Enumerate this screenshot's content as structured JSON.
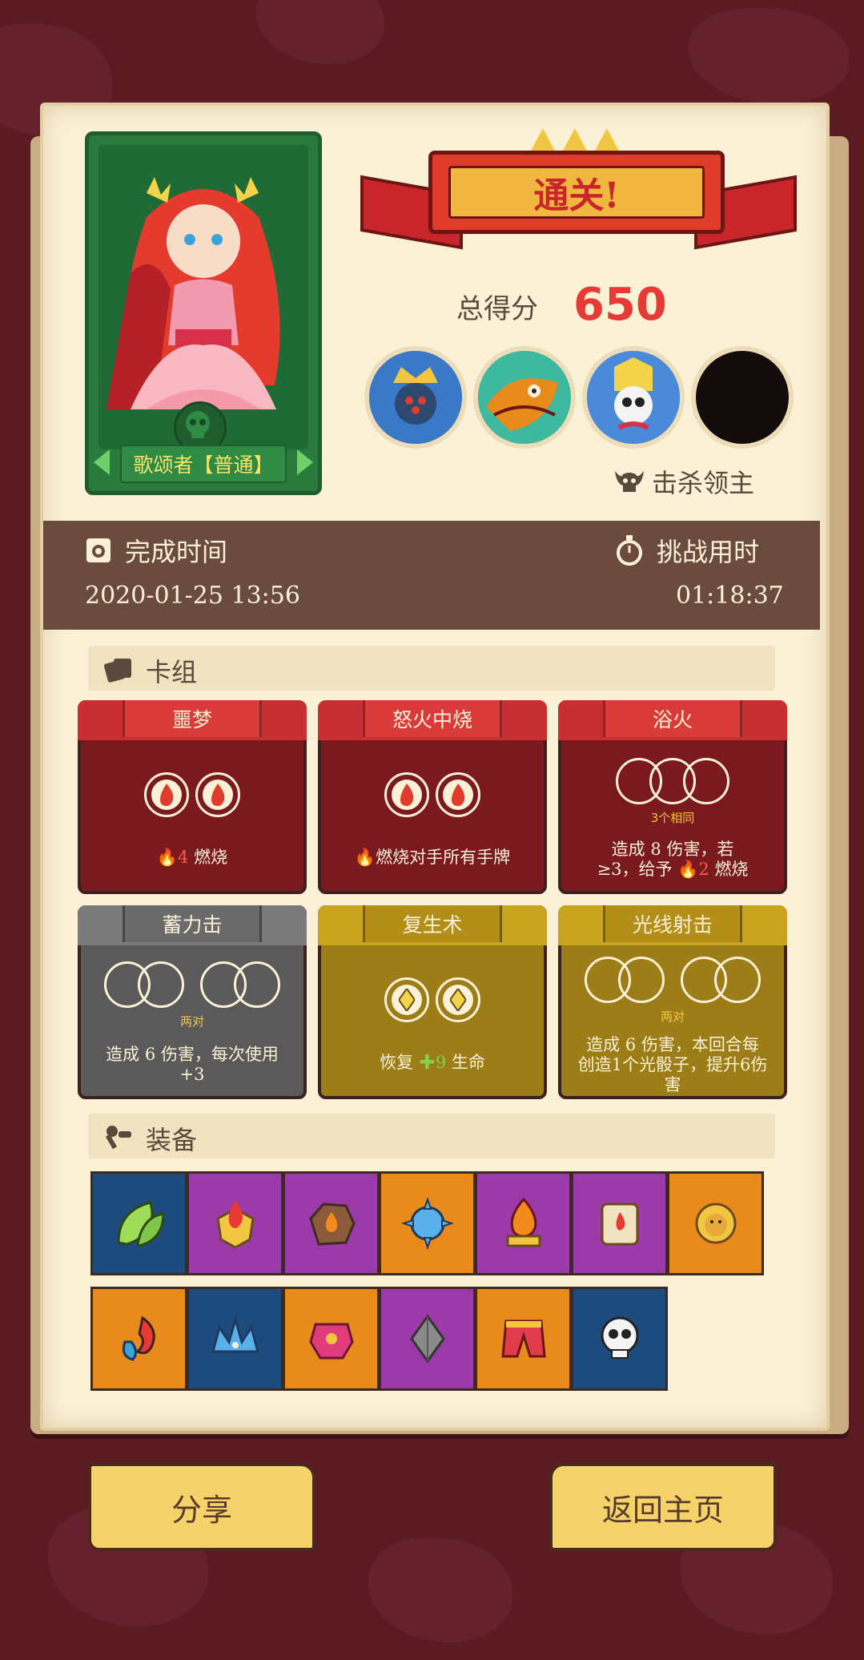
{
  "result": {
    "banner": "通关!",
    "score_label": "总得分",
    "score_value": "650",
    "kill_label": "击杀领主"
  },
  "hero": {
    "name": "歌颂者【普通】"
  },
  "bosses": [
    {
      "name": "boss-1-portrait"
    },
    {
      "name": "boss-2-portrait"
    },
    {
      "name": "boss-3-portrait"
    },
    {
      "name": "boss-4-locked"
    }
  ],
  "times": {
    "complete_label": "完成时间",
    "complete_value": "2020-01-25 13:56",
    "challenge_label": "挑战用时",
    "challenge_value": "01:18:37"
  },
  "deck": {
    "title": "卡组",
    "cards": [
      {
        "title": "噩梦",
        "color": "red",
        "dice": "fire-2",
        "effect_num": "4",
        "effect_text": "燃烧"
      },
      {
        "title": "怒火中烧",
        "color": "red",
        "dice": "fire-2",
        "effect_text": "燃烧对手所有手牌"
      },
      {
        "title": "浴火",
        "color": "red",
        "dice": "triple",
        "condition": "3个相同",
        "effect_line1": "造成 8 伤害，若",
        "effect_line2_a": "≥3，给予",
        "effect_line2_num": "2",
        "effect_line2_b": "燃烧"
      },
      {
        "title": "蓄力击",
        "color": "grey",
        "dice": "two-pair",
        "condition": "两对",
        "effect_line1": "造成 6 伤害，每次使用",
        "effect_line2": "+3"
      },
      {
        "title": "复生术",
        "color": "gold",
        "dice": "diamond-2",
        "effect_a": "恢复",
        "effect_num": "9",
        "effect_b": "生命"
      },
      {
        "title": "光线射击",
        "color": "gold",
        "dice": "two-pair",
        "condition": "两对",
        "effect_line1": "造成 6 伤害，本回合每",
        "effect_line2": "创造1个光骰子，提升6伤",
        "effect_line3": "害"
      }
    ]
  },
  "equipment": {
    "title": "装备",
    "row1": [
      {
        "icon": "leaf-icon",
        "bg": "#1e4b7e"
      },
      {
        "icon": "flame-shield-icon",
        "bg": "#9b3aa8"
      },
      {
        "icon": "fire-rock-icon",
        "bg": "#9b3aa8"
      },
      {
        "icon": "ice-mace-icon",
        "bg": "#e88a1c"
      },
      {
        "icon": "fire-altar-icon",
        "bg": "#9b3aa8"
      },
      {
        "icon": "fire-scroll-icon",
        "bg": "#9b3aa8"
      },
      {
        "icon": "lion-belt-icon",
        "bg": "#e88a1c"
      }
    ],
    "row2": [
      {
        "icon": "red-blue-drop-icon",
        "bg": "#e88a1c"
      },
      {
        "icon": "ice-crown-icon",
        "bg": "#1e4b7e"
      },
      {
        "icon": "jeweled-armor-icon",
        "bg": "#e88a1c"
      },
      {
        "icon": "grey-crystal-icon",
        "bg": "#9b3aa8"
      },
      {
        "icon": "red-pants-icon",
        "bg": "#e88a1c"
      },
      {
        "icon": "skull-icon",
        "bg": "#1e4b7e"
      }
    ]
  },
  "buttons": {
    "share": "分享",
    "home": "返回主页"
  },
  "colors": {
    "background": "#5a1b22",
    "panel": "#fbf1d7",
    "accent_red": "#e83a34",
    "time_bar": "#6b4b3e"
  }
}
